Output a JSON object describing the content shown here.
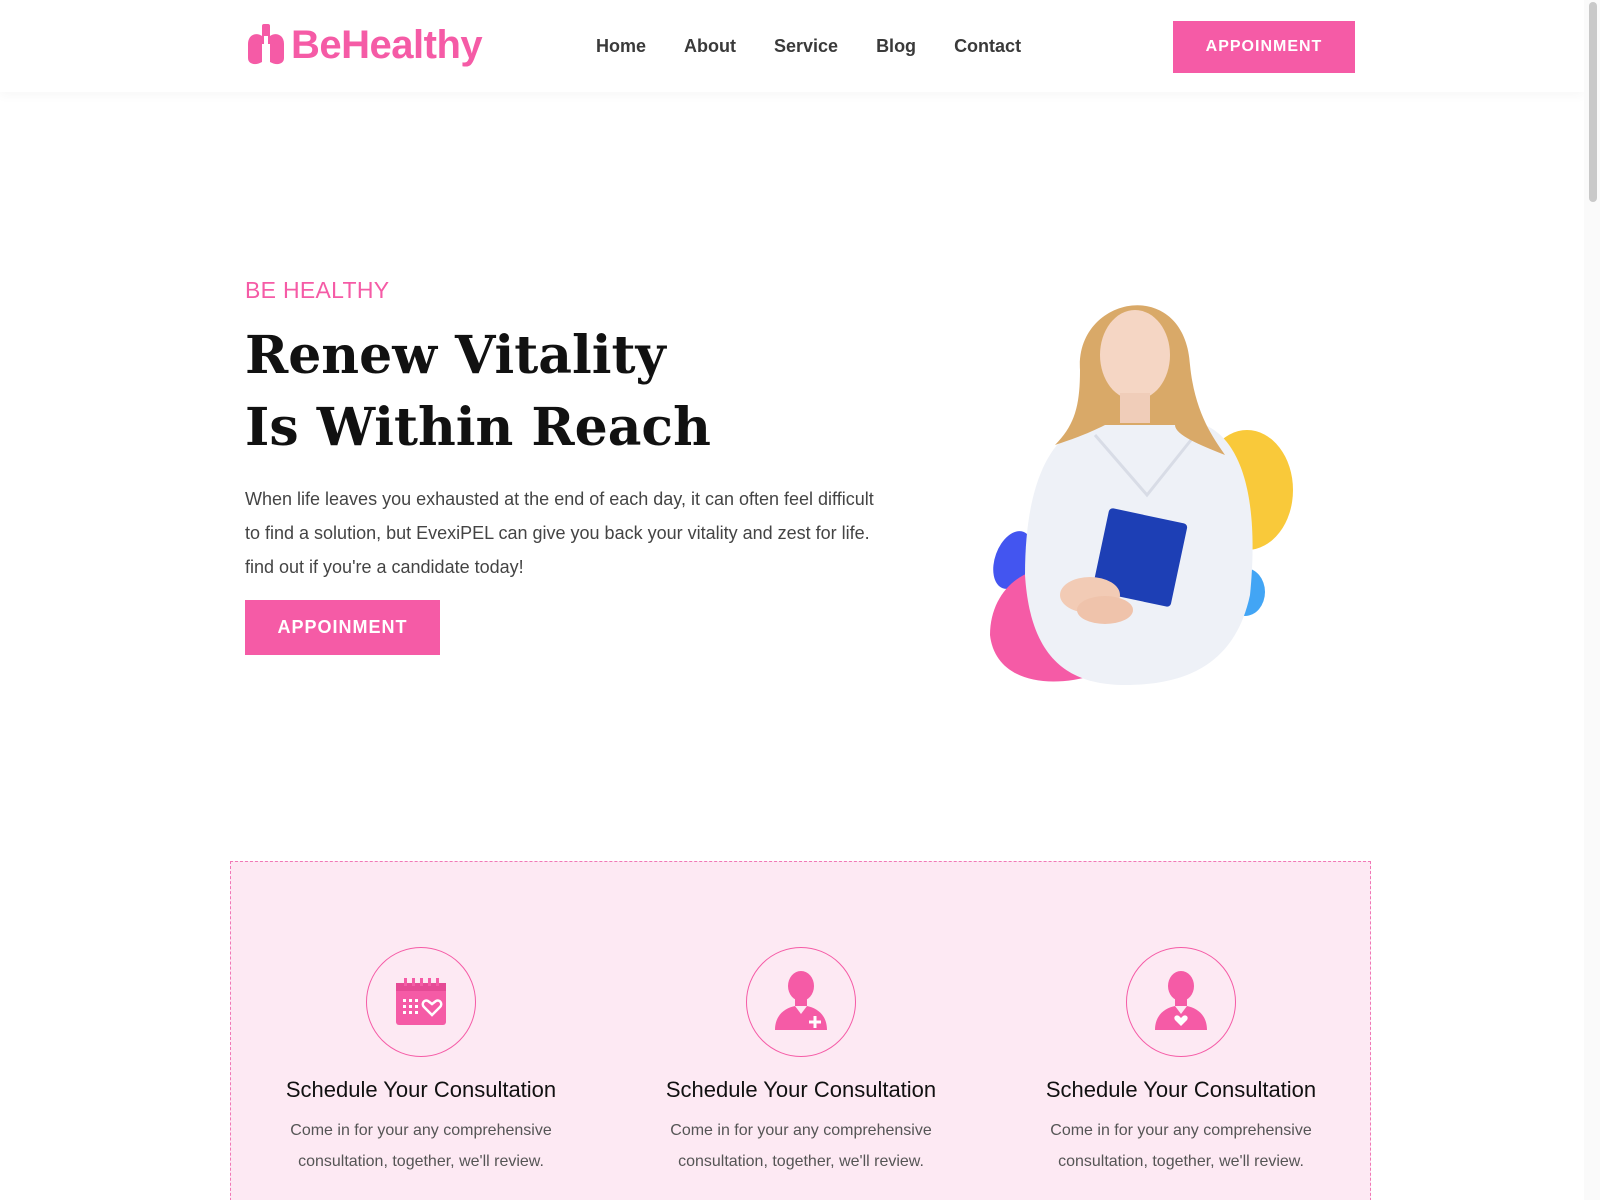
{
  "brand": {
    "name": "BeHealthy",
    "logo_icon": "lungs-icon",
    "accent": "#f55ba6"
  },
  "nav": {
    "items": [
      "Home",
      "About",
      "Service",
      "Blog",
      "Contact"
    ]
  },
  "header": {
    "cta_label": "APPOINMENT"
  },
  "hero": {
    "eyebrow": "BE HEALTHY",
    "title_line1": "Renew Vitality",
    "title_line2": "Is Within Reach",
    "text": "When life leaves you exhausted at the end of each day, it can often feel difficult to find a solution, but EvexiPEL can give you back your vitality and zest for life. find out if you're a candidate today!",
    "cta_label": "APPOINMENT",
    "image_alt": "doctor-holding-book-illustration",
    "blob_colors": [
      "#f9c93a",
      "#4355f0",
      "#f55ba6",
      "#42a5f5"
    ]
  },
  "features": [
    {
      "icon": "calendar-heart-icon",
      "title": "Schedule Your Consultation",
      "text": "Come in for your any comprehensive consultation, together, we'll review."
    },
    {
      "icon": "doctor-plus-icon",
      "title": "Schedule Your Consultation",
      "text": "Come in for your any comprehensive consultation, together, we'll review."
    },
    {
      "icon": "doctor-heart-icon",
      "title": "Schedule Your Consultation",
      "text": "Come in for your any comprehensive consultation, together, we'll review."
    }
  ]
}
